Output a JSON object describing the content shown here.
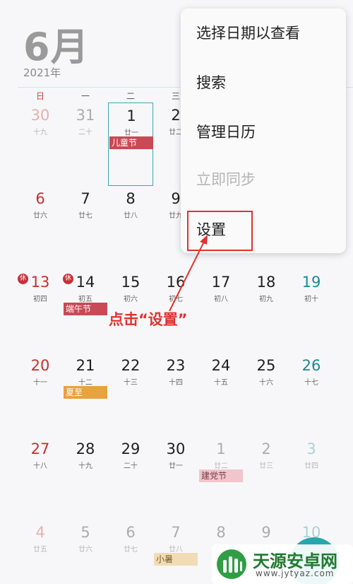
{
  "header": {
    "month": "6月",
    "year": "2021年"
  },
  "weekdays": [
    "日",
    "一",
    "二",
    "三"
  ],
  "weeks": [
    [
      {
        "num": "30",
        "lunar": "十九",
        "dim": true
      },
      {
        "num": "31",
        "lunar": "二十",
        "dim": true
      },
      {
        "num": "1",
        "lunar": "廿一",
        "today": true,
        "event": "儿童节",
        "event_color": "red"
      },
      {
        "num": "2",
        "lunar": "廿二"
      }
    ],
    [
      {
        "num": "6",
        "lunar": "廿六"
      },
      {
        "num": "7",
        "lunar": "廿七"
      },
      {
        "num": "8",
        "lunar": "廿八"
      },
      {
        "num": "9",
        "lunar": "廿九"
      }
    ],
    [
      {
        "num": "13",
        "lunar": "初四",
        "badge": "休"
      },
      {
        "num": "14",
        "lunar": "初五",
        "badge": "休",
        "event": "端午节",
        "event_color": "red"
      },
      {
        "num": "15",
        "lunar": "初六"
      },
      {
        "num": "16",
        "lunar": "初七"
      },
      {
        "num": "17",
        "lunar": "初八"
      },
      {
        "num": "18",
        "lunar": "初九"
      },
      {
        "num": "19",
        "lunar": "初十"
      }
    ],
    [
      {
        "num": "20",
        "lunar": "十一"
      },
      {
        "num": "21",
        "lunar": "十二",
        "event": "夏至",
        "event_color": "orange"
      },
      {
        "num": "22",
        "lunar": "十三"
      },
      {
        "num": "23",
        "lunar": "十四"
      },
      {
        "num": "24",
        "lunar": "十五"
      },
      {
        "num": "25",
        "lunar": "十六"
      },
      {
        "num": "26",
        "lunar": "十七"
      }
    ],
    [
      {
        "num": "27",
        "lunar": "十八"
      },
      {
        "num": "28",
        "lunar": "十九"
      },
      {
        "num": "29",
        "lunar": "二十"
      },
      {
        "num": "30",
        "lunar": "廿一"
      },
      {
        "num": "1",
        "lunar": "廿二",
        "dim": true,
        "event": "建党节",
        "event_color": "pink"
      },
      {
        "num": "2",
        "lunar": "廿三",
        "dim": true
      },
      {
        "num": "3",
        "lunar": "廿四",
        "dim": true
      }
    ],
    [
      {
        "num": "4",
        "lunar": "廿五",
        "dim": true
      },
      {
        "num": "5",
        "lunar": "廿六",
        "dim": true
      },
      {
        "num": "6",
        "lunar": "廿七",
        "dim": true
      },
      {
        "num": "7",
        "lunar": "廿八",
        "dim": true,
        "event": "小暑",
        "event_color": "beige"
      },
      {
        "num": "8",
        "lunar": "廿九",
        "dim": true
      },
      {
        "num": "9",
        "lunar": "三十",
        "dim": true
      },
      {
        "num": "10",
        "lunar": "初一",
        "dim": true
      }
    ]
  ],
  "menu": {
    "items": [
      {
        "label": "选择日期以查看",
        "enabled": true
      },
      {
        "label": "搜索",
        "enabled": true
      },
      {
        "label": "管理日历",
        "enabled": true
      },
      {
        "label": "立即同步",
        "enabled": false
      },
      {
        "label": "设置",
        "enabled": true
      }
    ]
  },
  "annotation": {
    "text": "点击“设置”",
    "color": "#e0322e"
  },
  "watermark": {
    "title": "天源安卓网",
    "url": "www.jytyaz.com"
  },
  "colors": {
    "accent": "#26a6ad",
    "sunday": "#c62f2f",
    "saturday": "#1b8a93"
  }
}
